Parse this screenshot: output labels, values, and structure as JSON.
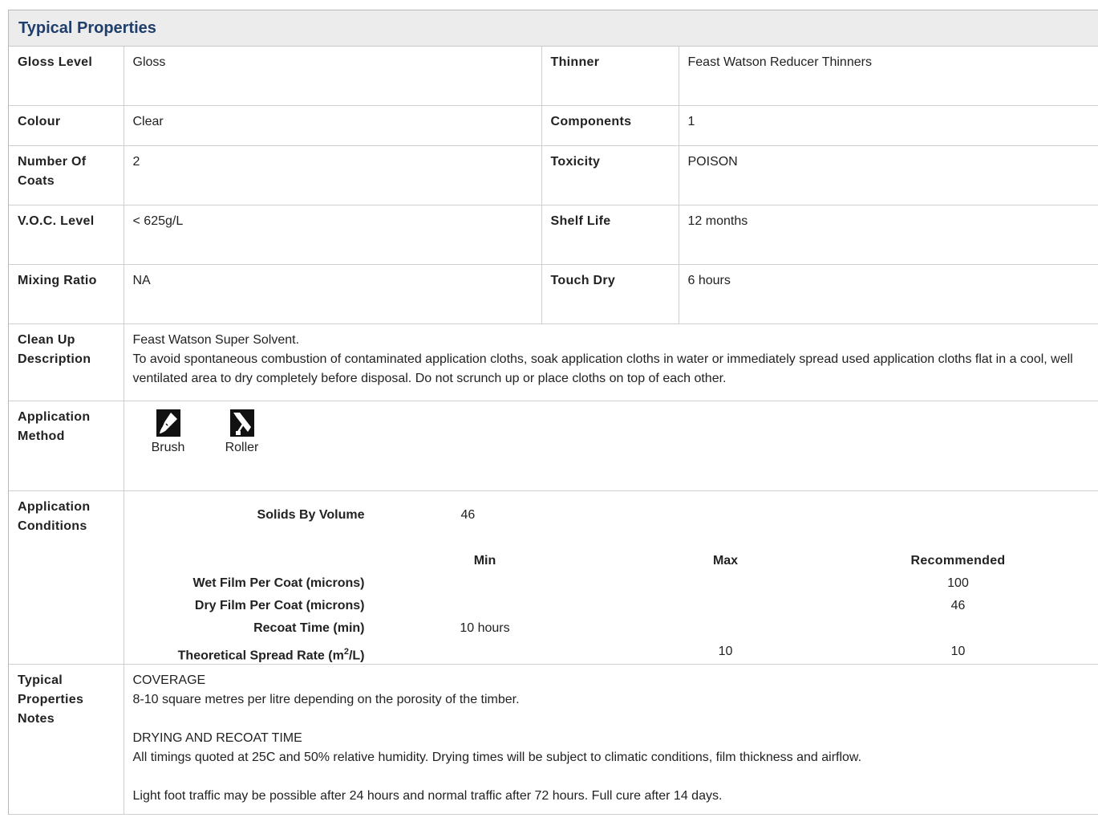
{
  "panel": {
    "title": "Typical Properties"
  },
  "rows": {
    "gloss": {
      "label": "Gloss Level",
      "value": "Gloss"
    },
    "thinner": {
      "label": "Thinner",
      "value": "Feast Watson Reducer Thinners"
    },
    "colour": {
      "label": "Colour",
      "value": "Clear"
    },
    "components": {
      "label": "Components",
      "value": "1"
    },
    "coats": {
      "label": "Number Of Coats",
      "value": "2"
    },
    "toxicity": {
      "label": "Toxicity",
      "value": "POISON"
    },
    "voc": {
      "label": "V.O.C. Level",
      "value": "< 625g/L"
    },
    "shelf": {
      "label": "Shelf Life",
      "value": "12 months"
    },
    "mixing": {
      "label": "Mixing Ratio",
      "value": "NA"
    },
    "touchdry": {
      "label": "Touch Dry",
      "value": "6 hours"
    }
  },
  "cleanup": {
    "label": "Clean Up Description",
    "line1": "Feast Watson Super Solvent.",
    "line2": "To avoid spontaneous combustion of contaminated application cloths, soak application cloths in water or immediately spread used application cloths flat in a cool, well ventilated area to dry completely before disposal. Do not scrunch up or place cloths on top of each other."
  },
  "application_method": {
    "label": "Application Method",
    "methods": [
      {
        "label": "Brush",
        "icon": "brush-icon"
      },
      {
        "label": "Roller",
        "icon": "roller-icon"
      }
    ]
  },
  "application_conditions": {
    "label": "Application Conditions",
    "solids_label": "Solids By Volume",
    "solids_value": "46",
    "headers": {
      "min": "Min",
      "max": "Max",
      "recommended": "Recommended"
    },
    "rows": [
      {
        "label": "Wet Film Per Coat (microns)",
        "min": "",
        "max": "",
        "recommended": "100"
      },
      {
        "label": "Dry Film Per Coat (microns)",
        "min": "",
        "max": "",
        "recommended": "46"
      },
      {
        "label": "Recoat Time (min)",
        "min": "10 hours",
        "max": "",
        "recommended": ""
      },
      {
        "label_pre": "Theoretical Spread Rate (m",
        "label_sup": "2",
        "label_post": "/L)",
        "min": "",
        "max": "10",
        "recommended": "10"
      }
    ]
  },
  "notes": {
    "label": "Typical Properties Notes",
    "coverage_heading": "COVERAGE",
    "coverage_text": "8-10 square metres per litre depending on the porosity of the timber.",
    "drying_heading": "DRYING AND RECOAT TIME",
    "drying_text": "All timings quoted at 25C and 50% relative humidity. Drying times will be subject to climatic conditions, film thickness and airflow.",
    "traffic_text": "Light foot traffic may be possible after 24 hours and normal traffic after 72 hours. Full cure after 14 days."
  }
}
